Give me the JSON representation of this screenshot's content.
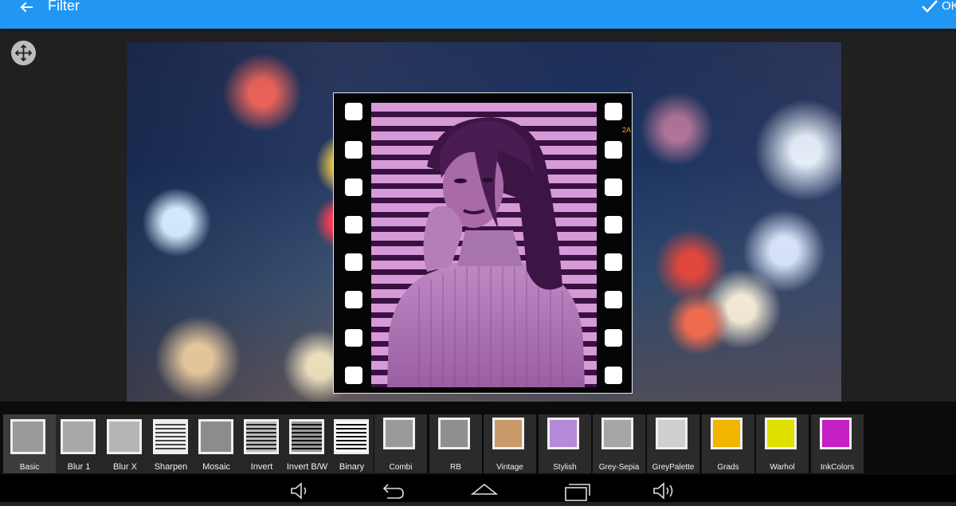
{
  "appbar": {
    "title": "Filter",
    "back_icon": "arrow-left-icon",
    "ok_label": "OK",
    "ok_icon": "checkmark-icon",
    "color": "#2196f3"
  },
  "canvas": {
    "move_icon": "move-arrows-icon",
    "frame_tag": "2A"
  },
  "filters": [
    {
      "label": "Basic",
      "tint": "#9a9a9a",
      "selected": true
    },
    {
      "label": "Blur 1",
      "tint": "#a8a8a8"
    },
    {
      "label": "Blur X",
      "tint": "#b5b5b5"
    },
    {
      "label": "Sharpen",
      "tint": "#6d6d6d"
    },
    {
      "label": "Mosaic",
      "tint": "#8c8c8c"
    },
    {
      "label": "Invert",
      "tint": "#4a4a4a"
    },
    {
      "label": "Invert B/W",
      "tint": "#3a3a3a"
    },
    {
      "label": "Binary",
      "tint": "#1a1a1a"
    },
    {
      "label": "Combi",
      "tint": "#9a9a9a"
    },
    {
      "label": "RB",
      "tint": "#8f8f8f"
    },
    {
      "label": "Vintage",
      "tint": "#c99a6a"
    },
    {
      "label": "Stylish",
      "tint": "#b58ad8"
    },
    {
      "label": "Grey-Sepia",
      "tint": "#a6a6a6"
    },
    {
      "label": "GreyPalette",
      "tint": "#cfcfcf"
    },
    {
      "label": "Grads",
      "tint": "#f3b400"
    },
    {
      "label": "Warhol",
      "tint": "#e0e000"
    },
    {
      "label": "InkColors",
      "tint": "#c51fc5"
    }
  ],
  "navbar": {
    "icons": [
      "volume-down-icon",
      "back-icon",
      "home-icon",
      "recents-icon",
      "volume-up-icon"
    ]
  }
}
